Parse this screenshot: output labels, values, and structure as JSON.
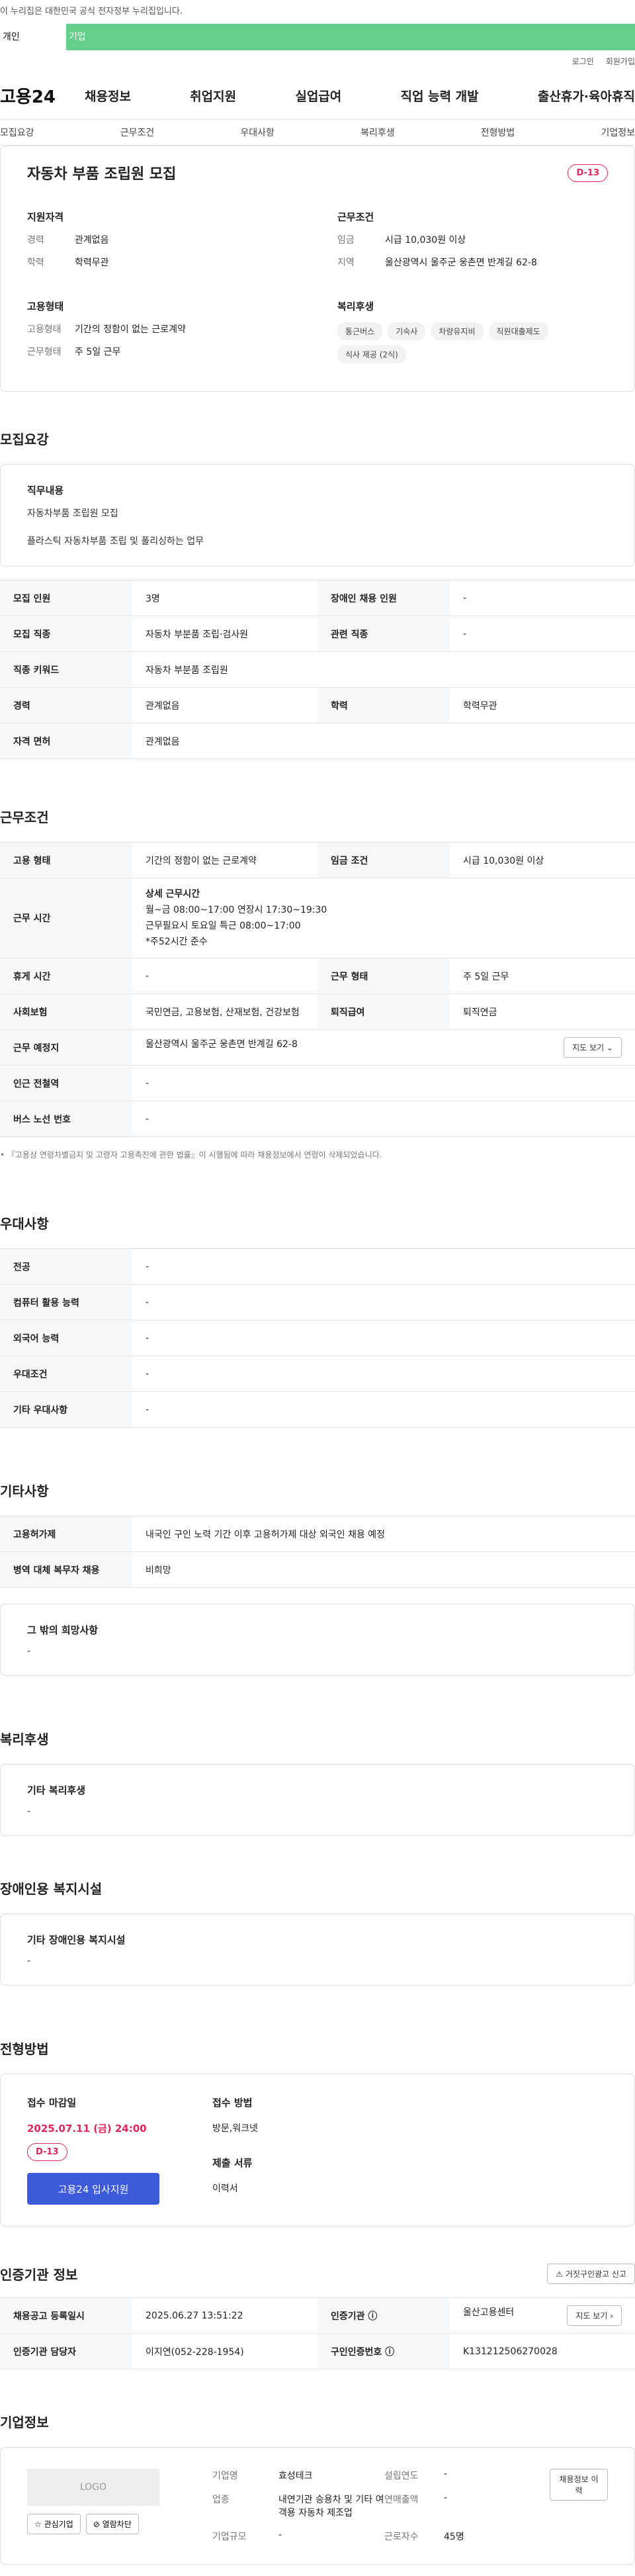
{
  "gov_banner": "이 누리집은 대한민국 공식 전자정부 누리집입니다.",
  "top_tabs": [
    "개인",
    "기업"
  ],
  "util": {
    "login": "로그인",
    "signup": "회원가입"
  },
  "gnb": {
    "logo": "고용24",
    "menu": [
      "채용정보",
      "취업지원",
      "실업급여",
      "직업 능력 개발",
      "출산휴가·육아휴직"
    ]
  },
  "subnav": [
    "모집요강",
    "근무조건",
    "우대사항",
    "복리후생",
    "전형방법",
    "기업정보"
  ],
  "summary": {
    "title": "자동차 부품 조립원 모집",
    "dday": "D-13",
    "qual": {
      "title": "지원자격",
      "career_k": "경력",
      "career_v": "관계없음",
      "edu_k": "학력",
      "edu_v": "학력무관"
    },
    "work": {
      "title": "근무조건",
      "wage_k": "임금",
      "wage_v": "시급 10,030원 이상",
      "region_k": "지역",
      "region_v": "울산광역시 울주군 웅촌면 반계길 62-8"
    },
    "emp": {
      "title": "고용형태",
      "type_k": "고용형태",
      "type_v": "기간의 정함이 없는 근로계약",
      "shape_k": "근무형태",
      "shape_v": "주 5일 근무"
    },
    "welfare": {
      "title": "복리후생",
      "chips": [
        "통근버스",
        "기숙사",
        "차량유지비",
        "직원대출제도",
        "식사 제공 (2식)"
      ]
    }
  },
  "recruit": {
    "title": "모집요강",
    "duty_title": "직무내용",
    "duty_lines": [
      "자동차부품 조립원 모집",
      "플라스틱 자동차부품 조립 및 폴리싱하는 업무"
    ],
    "rows": [
      [
        "모집 인원",
        "3명",
        "장애인 채용 인원",
        "-"
      ],
      [
        "모집 직종",
        "자동차 부분품 조립·검사원",
        "관련 직종",
        "-"
      ],
      [
        "직종 키워드",
        "자동차 부분품 조립원"
      ],
      [
        "경력",
        "관계없음",
        "학력",
        "학력무관"
      ],
      [
        "자격 면허",
        "관계없음"
      ]
    ]
  },
  "work": {
    "title": "근무조건",
    "type_k": "고용 형태",
    "type_v": "기간의 정함이 없는 근로계약",
    "wage_k": "임금 조건",
    "wage_v": "시급 10,030원 이상",
    "hours_k": "근무 시간",
    "hours_lines": [
      "상세 근무시간",
      "월~금 08:00~17:00 연장시 17:30~19:30",
      "근무필요시 토요일 특근 08:00~17:00",
      "*주52시간 준수"
    ],
    "rest_k": "휴게 시간",
    "rest_v": "-",
    "shape_k": "근무 형태",
    "shape_v": "주 5일 근무",
    "ins_k": "사회보험",
    "ins_v": "국민연금, 고용보험, 산재보험, 건강보험",
    "sev_k": "퇴직급여",
    "sev_v": "퇴직연금",
    "loc_k": "근무 예정지",
    "loc_v": "울산광역시 울주군 웅촌면 반계길 62-8",
    "map_btn": "지도 보기 ⌄",
    "sub_k": "인근 전철역",
    "sub_v": "-",
    "bus_k": "버스 노선 번호",
    "bus_v": "-",
    "note": "• 『고용상 연령차별금지 및 고령자 고용촉진에 관한 법률』이 시행됨에 따라 채용정보에서 연령이 삭제되었습니다."
  },
  "pref": {
    "title": "우대사항",
    "rows": [
      [
        "전공",
        "-"
      ],
      [
        "컴퓨터 활용 능력",
        "-"
      ],
      [
        "외국어 능력",
        "-"
      ],
      [
        "우대조건",
        "-"
      ],
      [
        "기타 우대사항",
        "-"
      ]
    ]
  },
  "etc": {
    "title": "기타사항",
    "rows": [
      [
        "고용허가제",
        "내국인 구인 노력 기간 이후 고용허가제 대상 외국인 채용 예정"
      ],
      [
        "병역 대체 복무자 채용",
        "비희망"
      ]
    ],
    "other_title": "그 밖의 희망사항",
    "other_v": "-"
  },
  "welfare": {
    "title": "복리후생",
    "sub": "기타 복리후생",
    "v": "-"
  },
  "disabled": {
    "title": "장애인용 복지시설",
    "sub": "기타 장애인용 복지시설",
    "v": "-"
  },
  "apply": {
    "title": "전형방법",
    "deadline_k": "접수 마감일",
    "deadline_v": "2025.07.11 (금) 24:00",
    "dday": "D-13",
    "btn": "고용24 입사지원",
    "method_k": "접수 방법",
    "method_v": "방문,워크넷",
    "docs_k": "제출 서류",
    "docs_v": "이력서"
  },
  "agency": {
    "title": "인증기관 정보",
    "report_btn": "⚠ 거짓구인광고 신고",
    "reg_k": "채용공고 등록일시",
    "reg_v": "2025.06.27 13:51:22",
    "org_k": "인증기관 ⓘ",
    "org_v": "울산고용센터",
    "map_btn": "지도 보기 ›",
    "mgr_k": "인증기관 담당자",
    "mgr_v": "이지연(052-228-1954)",
    "num_k": "구인인증번호 ⓘ",
    "num_v": "K131212506270028"
  },
  "company": {
    "title": "기업정보",
    "logo": "LOGO",
    "fav_btn": "☆ 관심기업",
    "block_btn": "⊘ 열람차단",
    "history_btn": "채용정보 이력",
    "name_k": "기업명",
    "name_v": "효성테크",
    "ind_k": "업종",
    "ind_v": "내연기관 승용차 및 기타 여객용 자동차 제조업",
    "size_k": "기업규모",
    "size_v": "-",
    "est_k": "설립연도",
    "est_v": "-",
    "sales_k": "연매출액",
    "sales_v": "-",
    "emp_k": "근로자수",
    "emp_v": "45명"
  }
}
